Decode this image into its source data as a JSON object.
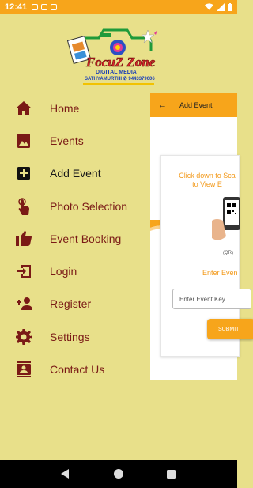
{
  "status_bar": {
    "time": "12:41"
  },
  "brand": {
    "name": "FocuZ Zone",
    "tagline": "DIGITAL MEDIA",
    "contact": "SATHYAMURTHI ✆ 9443379006"
  },
  "drawer": {
    "items": [
      {
        "label": "Home",
        "icon": "home-icon"
      },
      {
        "label": "Events",
        "icon": "image-icon"
      },
      {
        "label": "Add Event",
        "icon": "add-box-icon"
      },
      {
        "label": "Photo Selection",
        "icon": "touch-icon"
      },
      {
        "label": "Event Booking",
        "icon": "thumbs-up-icon"
      },
      {
        "label": "Login",
        "icon": "login-icon"
      },
      {
        "label": "Register",
        "icon": "person-add-icon"
      },
      {
        "label": "Settings",
        "icon": "gear-icon"
      },
      {
        "label": "Contact Us",
        "icon": "contact-icon"
      }
    ],
    "active_index": 2
  },
  "screen": {
    "title": "Add Event",
    "scan_line1": "Click down to Sca",
    "scan_line2": "to View E",
    "qr_label": "(QR)",
    "enter_text": "Enter Even",
    "key_placeholder": "Enter Event Key",
    "submit_label": "SUBMIT"
  },
  "colors": {
    "accent": "#f7a51b",
    "drawer_bg": "#e8e08a",
    "label": "#7a1a16",
    "icon": "#7a1a16"
  }
}
